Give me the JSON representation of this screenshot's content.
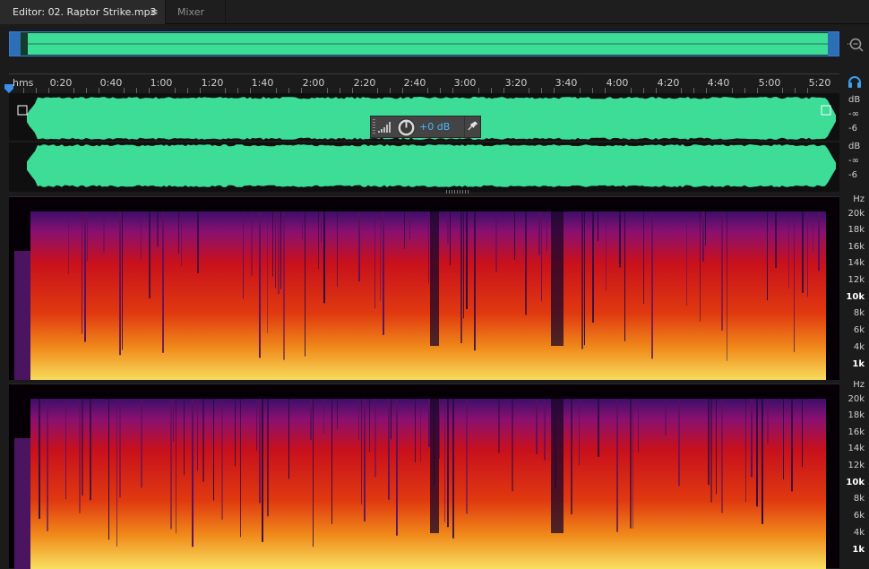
{
  "tabs": {
    "editor": "Editor: 02. Raptor Strike.mp3",
    "menu_glyph": "≡",
    "mixer": "Mixer"
  },
  "ruler": {
    "unit": "hms",
    "ticks": [
      "0:20",
      "0:40",
      "1:00",
      "1:20",
      "1:40",
      "2:00",
      "2:20",
      "2:40",
      "3:00",
      "3:20",
      "3:40",
      "4:00",
      "4:20",
      "4:40",
      "5:00",
      "5:20"
    ]
  },
  "hud": {
    "gain": "+0 dB"
  },
  "db_scale": {
    "unit": "dB",
    "inf": "-∞",
    "minus6": "-6"
  },
  "hz_scale": {
    "unit": "Hz",
    "labels": [
      "20k",
      "18k",
      "16k",
      "14k",
      "12k",
      "10k",
      "8k",
      "6k",
      "4k",
      "1k"
    ]
  },
  "icons": {
    "zoom": "zoom-navigator-icon",
    "headphones": "headphones-icon",
    "playhead": "playhead-marker-icon",
    "volume": "volume-bars-icon",
    "knob": "gain-knob-icon",
    "pin": "pin-icon"
  },
  "colors": {
    "waveform": "#3ddc97",
    "accent_blue": "#3b7bd1",
    "gain_text": "#4bb6ff"
  }
}
